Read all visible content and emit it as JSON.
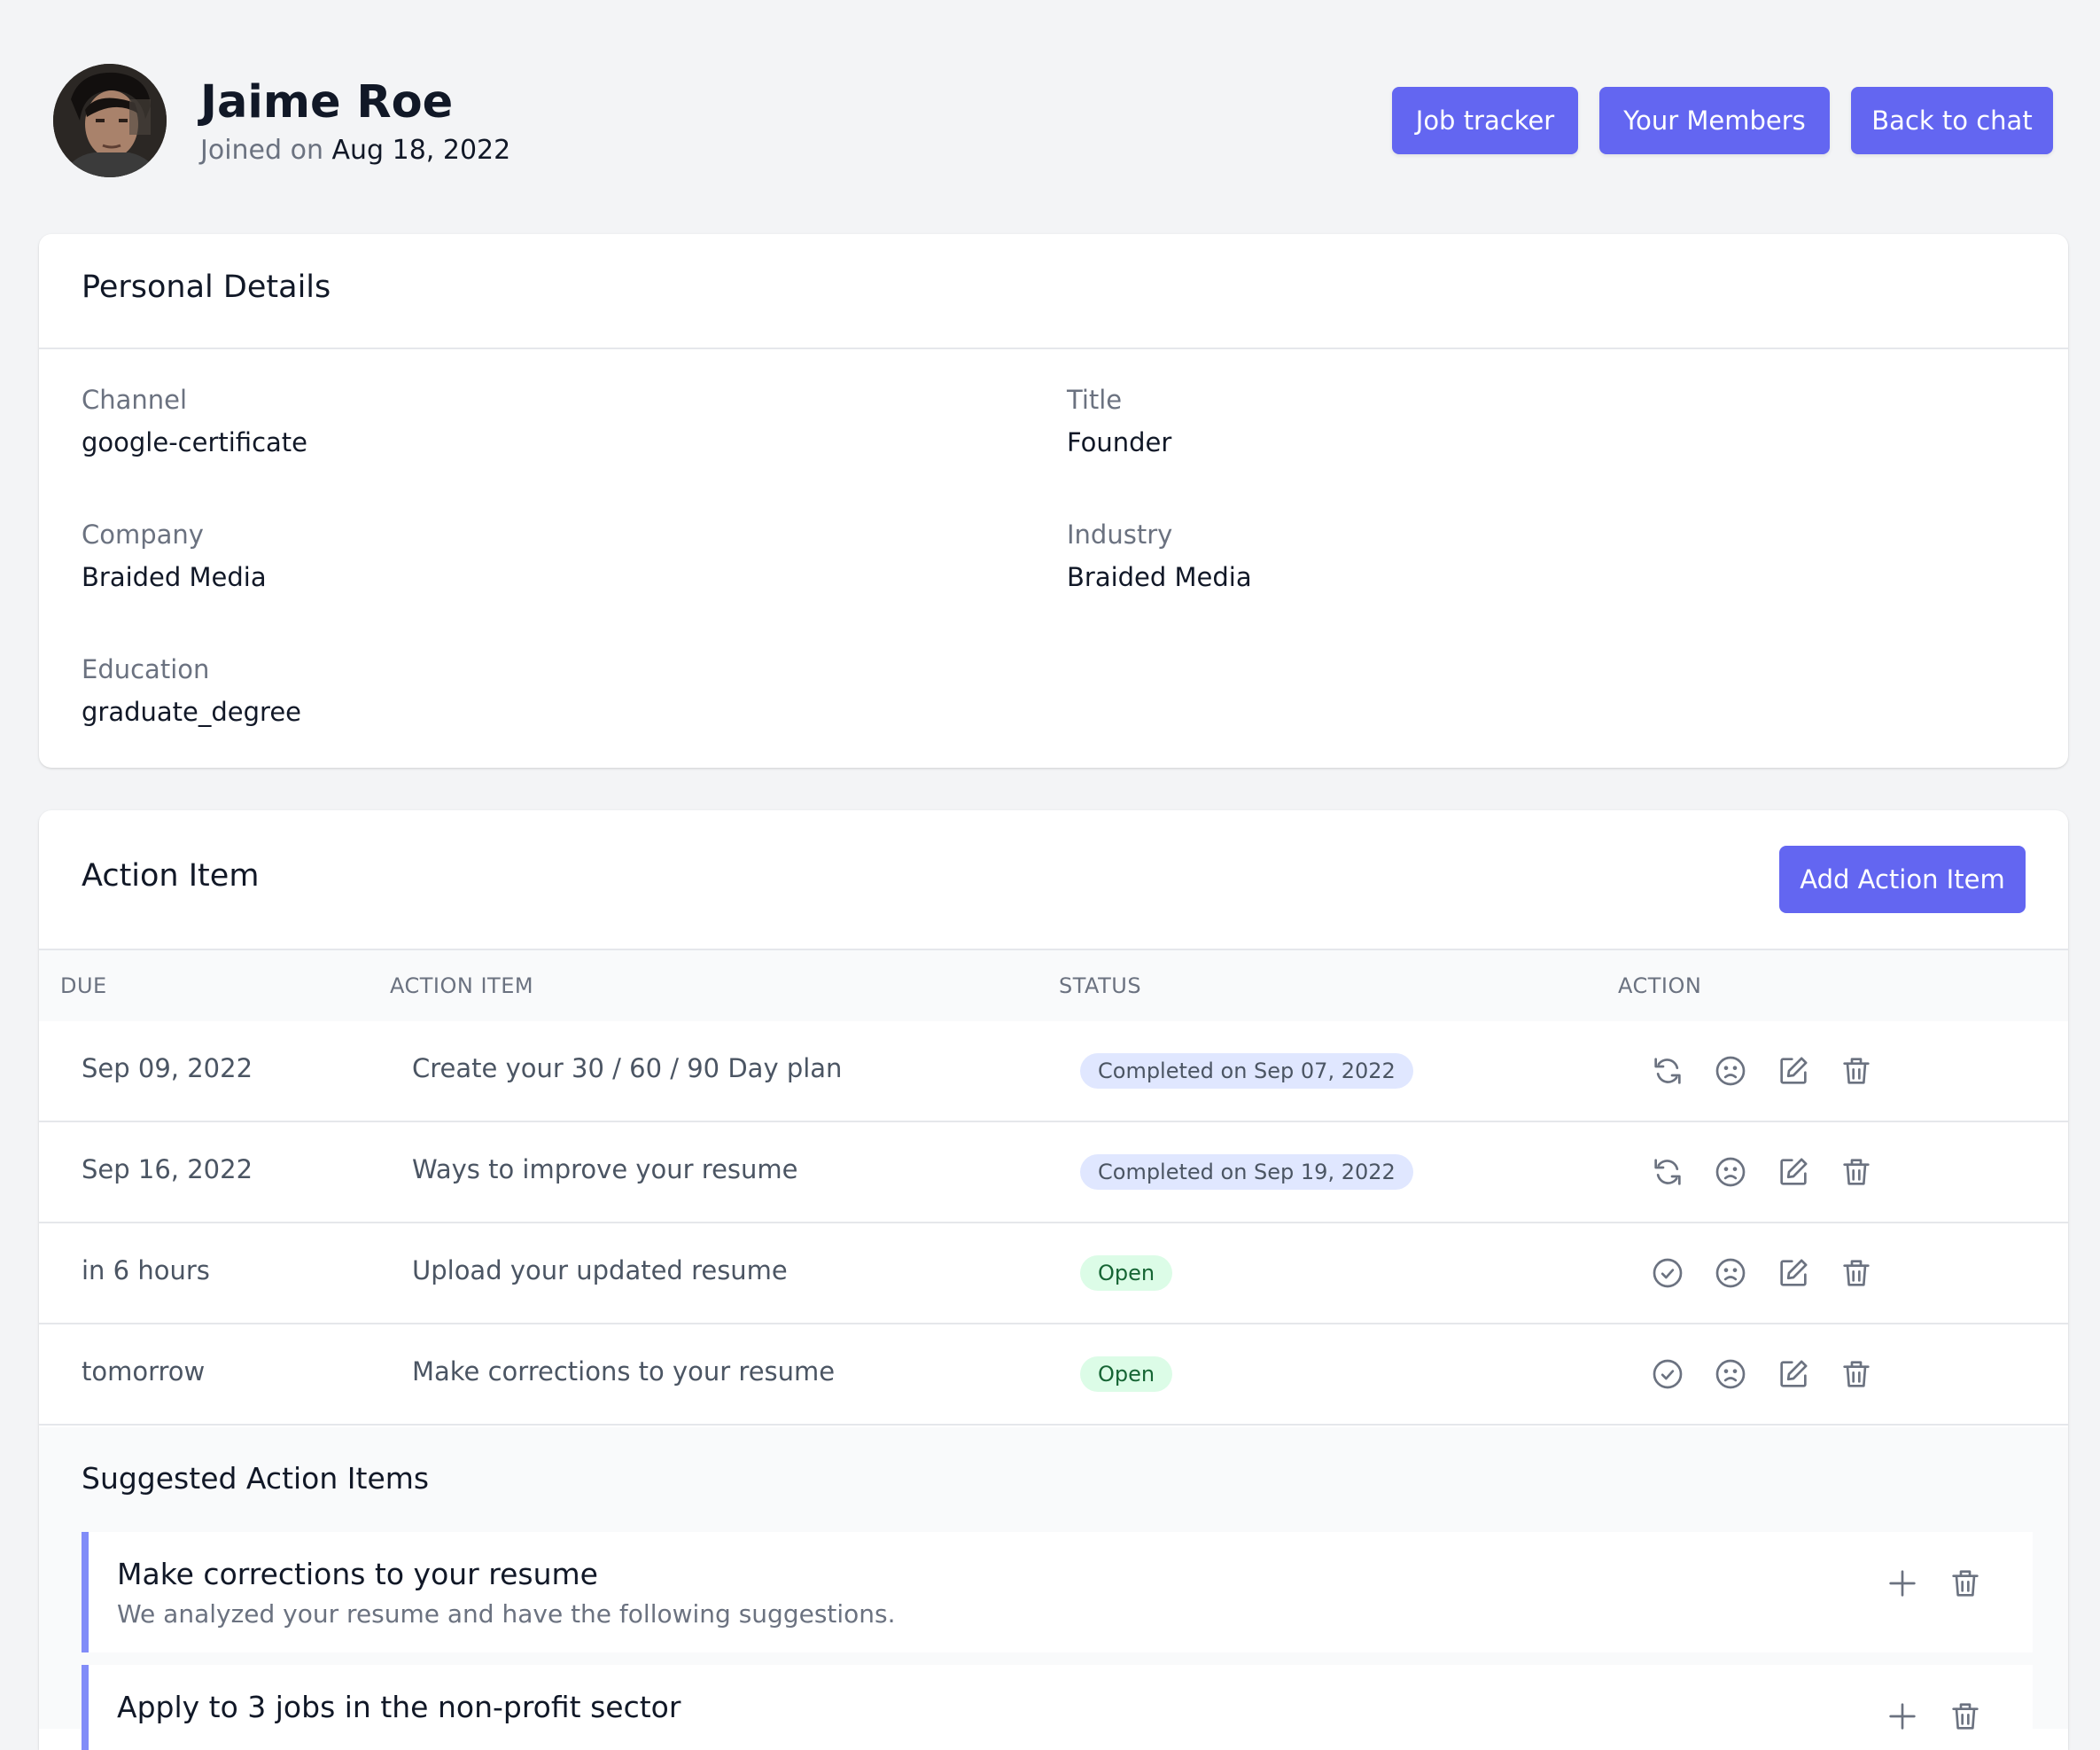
{
  "profile": {
    "name": "Jaime Roe",
    "joined_label": "Joined on",
    "joined_date": "Aug 18, 2022"
  },
  "nav": {
    "job_tracker": "Job tracker",
    "your_members": "Your Members",
    "back_to_chat": "Back to chat"
  },
  "personal": {
    "title": "Personal Details",
    "channel_label": "Channel",
    "channel_value": "google-certificate",
    "title_label": "Title",
    "title_value": "Founder",
    "company_label": "Company",
    "company_value": "Braided Media",
    "industry_label": "Industry",
    "industry_value": "Braided Media",
    "education_label": "Education",
    "education_value": "graduate_degree"
  },
  "actions": {
    "title": "Action Item",
    "add_label": "Add Action Item",
    "headers": {
      "due": "DUE",
      "item": "ACTION ITEM",
      "status": "STATUS",
      "action": "ACTION"
    },
    "rows": [
      {
        "due": "Sep 09, 2022",
        "item": "Create your 30 / 60 / 90 Day plan",
        "status": "Completed on Sep 07, 2022",
        "state": "completed",
        "first_icon": "refresh-icon"
      },
      {
        "due": "Sep 16, 2022",
        "item": "Ways to improve your resume",
        "status": "Completed on Sep 19, 2022",
        "state": "completed",
        "first_icon": "refresh-icon"
      },
      {
        "due": "in 6 hours",
        "item": "Upload your updated resume",
        "status": "Open",
        "state": "open",
        "first_icon": "check-circle-icon"
      },
      {
        "due": "tomorrow",
        "item": "Make corrections to your resume",
        "status": "Open",
        "state": "open",
        "first_icon": "check-circle-icon"
      }
    ]
  },
  "suggested": {
    "title": "Suggested Action Items",
    "items": [
      {
        "title": "Make corrections to your resume",
        "description": "We analyzed your resume and have the following suggestions."
      },
      {
        "title": "Apply to 3 jobs in the non-profit sector",
        "description": ""
      }
    ]
  },
  "colors": {
    "accent": "#6366f1",
    "completed_badge_bg": "#e0e7ff",
    "open_badge_bg": "#dcfce7",
    "open_badge_text": "#166534",
    "suggestion_border": "#818cf8"
  }
}
